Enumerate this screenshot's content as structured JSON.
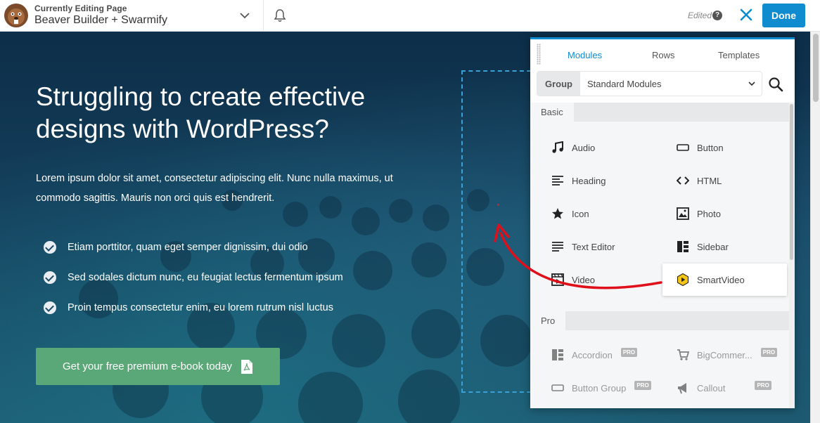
{
  "topbar": {
    "context_label": "Currently Editing Page",
    "page_title": "Beaver Builder + Swarmify",
    "status": "Edited",
    "help": "?",
    "done_label": "Done"
  },
  "hero": {
    "title": "Struggling to create effective designs with WordPress?",
    "body": "Lorem ipsum dolor sit amet, consectetur adipiscing elit. Nunc nulla maximus, ut commodo sagittis. Mauris non orci quis est hendrerit.",
    "bullets": [
      "Etiam porttitor, quam eget semper dignissim, dui odio",
      "Sed sodales dictum nunc, eu feugiat lectus fermentum ipsum",
      "Proin tempus consectetur enim, eu lorem  rutrum nisl luctus"
    ],
    "cta_label": "Get your free premium e-book today"
  },
  "panel": {
    "tabs": [
      "Modules",
      "Rows",
      "Templates"
    ],
    "active_tab": "Modules",
    "group_label": "Group",
    "group_value": "Standard Modules",
    "sections": {
      "basic": {
        "label": "Basic",
        "modules": [
          {
            "label": "Audio",
            "icon": "music-note-icon"
          },
          {
            "label": "Button",
            "icon": "button-icon"
          },
          {
            "label": "Heading",
            "icon": "heading-icon"
          },
          {
            "label": "HTML",
            "icon": "code-icon"
          },
          {
            "label": "Icon",
            "icon": "star-icon"
          },
          {
            "label": "Photo",
            "icon": "photo-icon"
          },
          {
            "label": "Text Editor",
            "icon": "text-editor-icon"
          },
          {
            "label": "Sidebar",
            "icon": "sidebar-icon"
          },
          {
            "label": "Video",
            "icon": "video-icon"
          },
          {
            "label": "SmartVideo",
            "icon": "smartvideo-icon"
          }
        ]
      },
      "pro": {
        "label": "Pro",
        "badge": "PRO",
        "modules": [
          {
            "label": "Accordion",
            "icon": "accordion-icon"
          },
          {
            "label": "BigCommer...",
            "icon": "cart-icon"
          },
          {
            "label": "Button Group",
            "icon": "button-group-icon"
          },
          {
            "label": "Callout",
            "icon": "megaphone-icon"
          }
        ]
      }
    }
  },
  "colors": {
    "accent": "#0e8ccf",
    "cta": "#5aa878",
    "arrow": "#e0101a",
    "smartvideo": "#f5c518"
  }
}
